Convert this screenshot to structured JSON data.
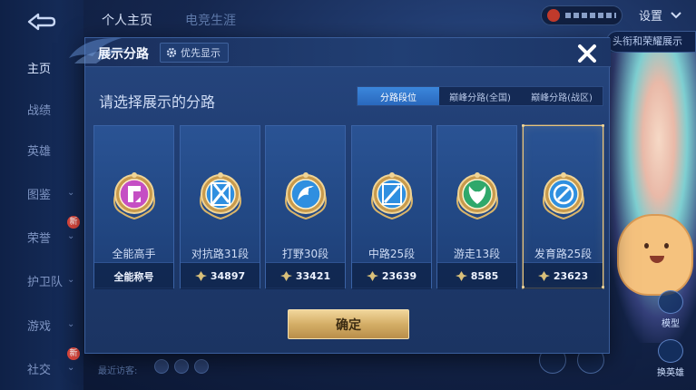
{
  "top": {
    "tab_profile": "个人主页",
    "tab_second": "电竞生涯",
    "settings_label": "设置",
    "peek_label": "头衔和荣耀展示"
  },
  "sidebar": {
    "items": [
      {
        "label": "主页",
        "active": true,
        "icon": "chevron-down-icon"
      },
      {
        "label": "战绩",
        "active": false
      },
      {
        "label": "英雄",
        "active": false
      },
      {
        "label": "图鉴",
        "active": false,
        "chevron": true
      },
      {
        "label": "荣誉",
        "active": false,
        "chevron": true,
        "badge": "新"
      },
      {
        "label": "护卫队",
        "active": false,
        "chevron": true
      },
      {
        "label": "游戏",
        "active": false,
        "chevron": true
      },
      {
        "label": "社交",
        "active": false,
        "chevron": true,
        "badge": "新"
      }
    ]
  },
  "bottom": {
    "recent_label": "最近访客:"
  },
  "right_buttons": [
    {
      "label": "模型",
      "icon": "model-icon"
    },
    {
      "label": "换英雄",
      "icon": "swap-hero-icon"
    }
  ],
  "modal": {
    "title": "展示分路",
    "priority_label": "优先显示",
    "subtitle": "请选择展示的分路",
    "tabs": [
      {
        "label": "分路段位",
        "active": true
      },
      {
        "label": "巅峰分路(全国)",
        "active": false
      },
      {
        "label": "巅峰分路(战区)",
        "active": false
      }
    ],
    "cards": [
      {
        "lane": "全能高手",
        "value": "全能称号",
        "show_power": false,
        "selected": false,
        "emblem": "all-round-emblem-icon",
        "color": "#c54fc4"
      },
      {
        "lane": "对抗路31段",
        "value": "34897",
        "show_power": true,
        "selected": false,
        "emblem": "clash-lane-emblem-icon",
        "color": "#2f8fe0"
      },
      {
        "lane": "打野30段",
        "value": "33421",
        "show_power": true,
        "selected": false,
        "emblem": "jungle-emblem-icon",
        "color": "#2f8fe0"
      },
      {
        "lane": "中路25段",
        "value": "23639",
        "show_power": true,
        "selected": false,
        "emblem": "mid-lane-emblem-icon",
        "color": "#2f8fe0"
      },
      {
        "lane": "游走13段",
        "value": "8585",
        "show_power": true,
        "selected": false,
        "emblem": "roam-emblem-icon",
        "color": "#2fa86b"
      },
      {
        "lane": "发育路25段",
        "value": "23623",
        "show_power": true,
        "selected": true,
        "emblem": "farm-lane-emblem-icon",
        "color": "#2f8fe0"
      }
    ],
    "confirm_label": "确定"
  },
  "colors": {
    "accent_blue": "#2a68bd",
    "gold": "#d4ae67",
    "panel": "#1e3a6d"
  }
}
